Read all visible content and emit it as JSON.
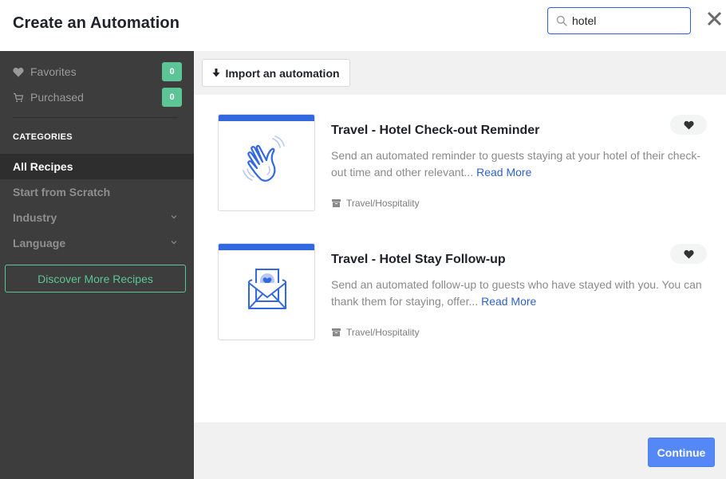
{
  "header": {
    "title": "Create an Automation",
    "search": {
      "value": "hotel",
      "placeholder": "Search",
      "icon": "search-icon"
    },
    "close_icon": "close-icon"
  },
  "sidebar": {
    "top_items": [
      {
        "label": "Favorites",
        "icon": "heart-icon",
        "count": "0"
      },
      {
        "label": "Purchased",
        "icon": "cart-icon",
        "count": "0"
      }
    ],
    "categories_heading": "CATEGORIES",
    "categories": [
      {
        "label": "All Recipes",
        "active": true,
        "expandable": false
      },
      {
        "label": "Start from Scratch",
        "active": false,
        "expandable": false
      },
      {
        "label": "Industry",
        "active": false,
        "expandable": true
      },
      {
        "label": "Language",
        "active": false,
        "expandable": true
      }
    ],
    "discover_button": "Discover More Recipes"
  },
  "toolbar": {
    "import_button": "Import an automation",
    "import_icon": "download-arrow-icon"
  },
  "recipes": [
    {
      "title": "Travel - Hotel Check-out Reminder",
      "description": "Send an automated reminder to guests staying at your hotel of their check-out time and other relevant...",
      "read_more": "Read More",
      "category": "Travel/Hospitality",
      "thumbnail_icon": "waving-hand-icon",
      "favorite_icon": "heart-icon"
    },
    {
      "title": "Travel - Hotel Stay Follow-up",
      "description": "Send an automated follow-up to guests who have stayed with you. You can thank them for staying, offer...",
      "read_more": "Read More",
      "category": "Travel/Hospitality",
      "thumbnail_icon": "envelope-heart-icon",
      "favorite_icon": "heart-icon"
    }
  ],
  "footer": {
    "continue_button": "Continue"
  },
  "colors": {
    "accent_blue": "#3268e0",
    "continue_blue": "#5488f7",
    "badge_green": "#5dc495",
    "sidebar_bg": "#3d3d3d",
    "sidebar_active_bg": "#2e2e2e",
    "link_blue": "#2f62c8"
  }
}
